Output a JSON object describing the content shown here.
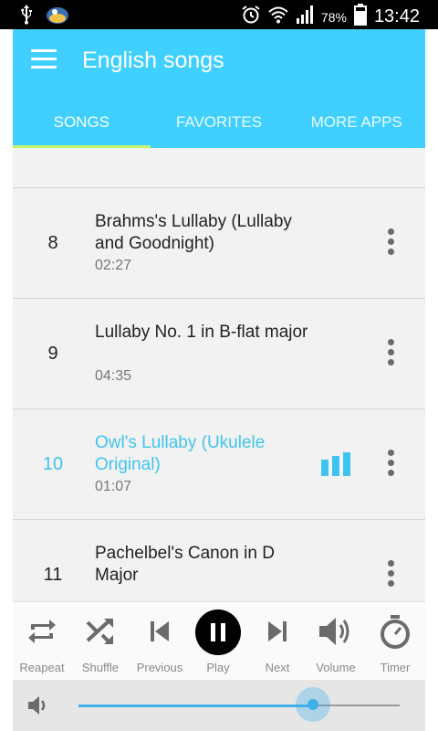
{
  "status_bar": {
    "battery": "78%",
    "time": "13:42",
    "icons": [
      "usb-icon",
      "app-notification-icon",
      "alarm-icon",
      "wifi-icon",
      "signal-icon",
      "battery-icon"
    ]
  },
  "app_bar": {
    "title": "English songs",
    "menu_icon": "hamburger-menu-icon",
    "accent": "#3fd0ff",
    "tab_indicator": "#c5f36b"
  },
  "tabs": [
    {
      "label": "SONGS",
      "active": true
    },
    {
      "label": "FAVORITES",
      "active": false
    },
    {
      "label": "MORE APPS",
      "active": false
    }
  ],
  "songs": [
    {
      "number": "8",
      "title": "Brahms's Lullaby (Lullaby and Goodnight)",
      "duration": "02:27",
      "playing": false
    },
    {
      "number": "9",
      "title": "Lullaby No. 1 in B-flat major",
      "duration": "04:35",
      "playing": false
    },
    {
      "number": "10",
      "title": "Owl's Lullaby (Ukulele Original)",
      "duration": "01:07",
      "playing": true
    },
    {
      "number": "11",
      "title": "Pachelbel's Canon in D Major",
      "duration": "",
      "playing": false
    }
  ],
  "playing_color": "#3fc4ef",
  "controls": [
    {
      "label": "Reapeat",
      "icon": "repeat-icon"
    },
    {
      "label": "Shuffle",
      "icon": "shuffle-icon"
    },
    {
      "label": "Previous",
      "icon": "previous-icon"
    },
    {
      "label": "Play",
      "icon": "pause-icon"
    },
    {
      "label": "Next",
      "icon": "next-icon"
    },
    {
      "label": "Volume",
      "icon": "volume-icon"
    },
    {
      "label": "Timer",
      "icon": "timer-icon"
    }
  ],
  "volume": {
    "icon": "speaker-icon",
    "level": 0.73,
    "color": "#3fb0e9"
  }
}
